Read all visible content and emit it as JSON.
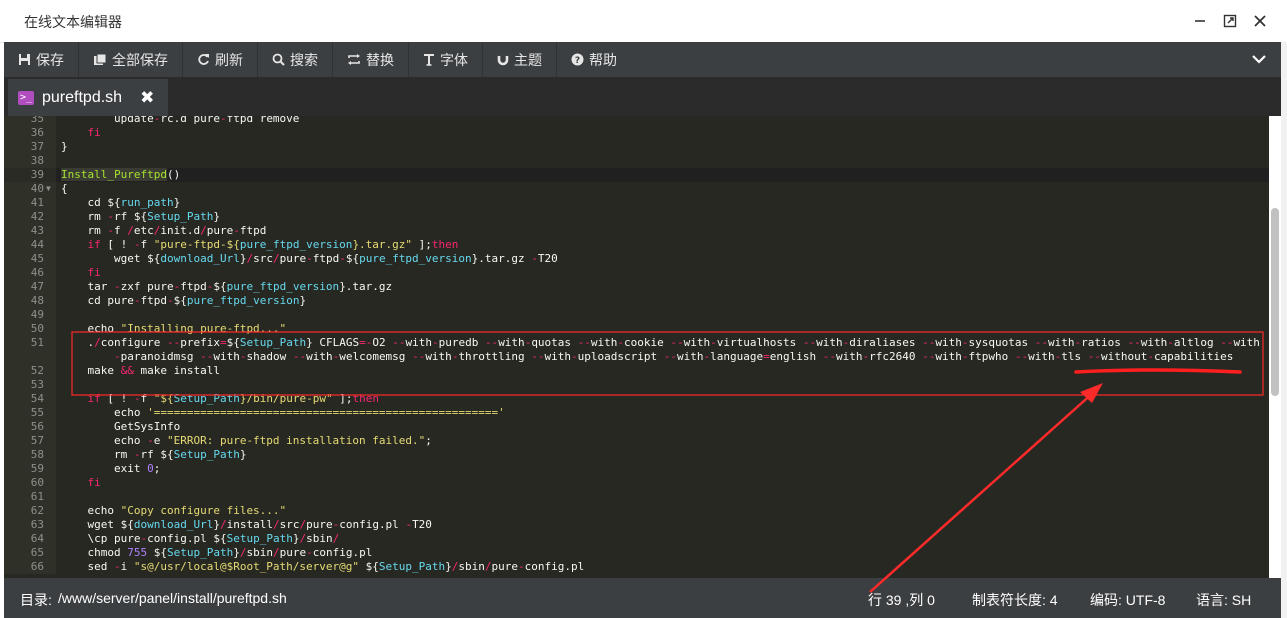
{
  "window": {
    "title": "在线文本编辑器"
  },
  "toolbar": {
    "save": "保存",
    "save_all": "全部保存",
    "refresh": "刷新",
    "search": "搜索",
    "replace": "替换",
    "font": "字体",
    "theme": "主题",
    "help": "帮助"
  },
  "tab": {
    "name": "pureftpd.sh",
    "close": "✖"
  },
  "status": {
    "path_label": "目录:",
    "path": "/www/server/panel/install/pureftpd.sh",
    "position": "行 39 ,列 0",
    "tab_size": "制表符长度: 4",
    "encoding": "编码: UTF-8",
    "language": "语言: SH"
  },
  "editor": {
    "active_line": 39,
    "lines": [
      {
        "n": "35",
        "t": "        update-rc.d pure-ftpd remove"
      },
      {
        "n": "36",
        "t": "    fi"
      },
      {
        "n": "37",
        "t": "}"
      },
      {
        "n": "38",
        "t": ""
      },
      {
        "n": "39",
        "t": "Install_Pureftpd()"
      },
      {
        "n": "40",
        "t": "{"
      },
      {
        "n": "41",
        "t": "    cd ${run_path}"
      },
      {
        "n": "42",
        "t": "    rm -rf ${Setup_Path}"
      },
      {
        "n": "43",
        "t": "    rm -f /etc/init.d/pure-ftpd"
      },
      {
        "n": "44",
        "t": "    if [ ! -f \"pure-ftpd-${pure_ftpd_version}.tar.gz\" ];then"
      },
      {
        "n": "45",
        "t": "        wget ${download_Url}/src/pure-ftpd-${pure_ftpd_version}.tar.gz -T20"
      },
      {
        "n": "46",
        "t": "    fi"
      },
      {
        "n": "47",
        "t": "    tar -zxf pure-ftpd-${pure_ftpd_version}.tar.gz"
      },
      {
        "n": "48",
        "t": "    cd pure-ftpd-${pure_ftpd_version}"
      },
      {
        "n": "49",
        "t": ""
      },
      {
        "n": "50",
        "t": "    echo \"Installing pure-ftpd...\""
      },
      {
        "n": "51",
        "t": "    ./configure --prefix=${Setup_Path} CFLAGS=-O2 --with-puredb --with-quotas --with-cookie --with-virtualhosts --with-diraliases --with-sysquotas --with-ratios --with-altlog --with"
      },
      {
        "n": "",
        "t": "        -paranoidmsg --with-shadow --with-welcomemsg --with-throttling --with-uploadscript --with-language=english --with-rfc2640 --with-ftpwho --with-tls --without-capabilities"
      },
      {
        "n": "52",
        "t": "    make && make install"
      },
      {
        "n": "53",
        "t": ""
      },
      {
        "n": "54",
        "t": "    if [ ! -f \"${Setup_Path}/bin/pure-pw\" ];then"
      },
      {
        "n": "55",
        "t": "        echo '===================================================='"
      },
      {
        "n": "56",
        "t": "        GetSysInfo"
      },
      {
        "n": "57",
        "t": "        echo -e \"ERROR: pure-ftpd installation failed.\";"
      },
      {
        "n": "58",
        "t": "        rm -rf ${Setup_Path}"
      },
      {
        "n": "59",
        "t": "        exit 0;"
      },
      {
        "n": "60",
        "t": "    fi"
      },
      {
        "n": "61",
        "t": ""
      },
      {
        "n": "62",
        "t": "    echo \"Copy configure files...\""
      },
      {
        "n": "63",
        "t": "    wget ${download_Url}/install/src/pure-config.pl -T20"
      },
      {
        "n": "64",
        "t": "    \\cp pure-config.pl ${Setup_Path}/sbin/"
      },
      {
        "n": "65",
        "t": "    chmod 755 ${Setup_Path}/sbin/pure-config.pl"
      },
      {
        "n": "66",
        "t": "    sed -i \"s@/usr/local@$Root_Path/server@g\" ${Setup_Path}/sbin/pure-config.pl"
      }
    ]
  },
  "colors": {
    "editor_bg": "#272822",
    "toolbar_bg": "#3c3f41",
    "annotation_red": "#ff2a2a"
  }
}
